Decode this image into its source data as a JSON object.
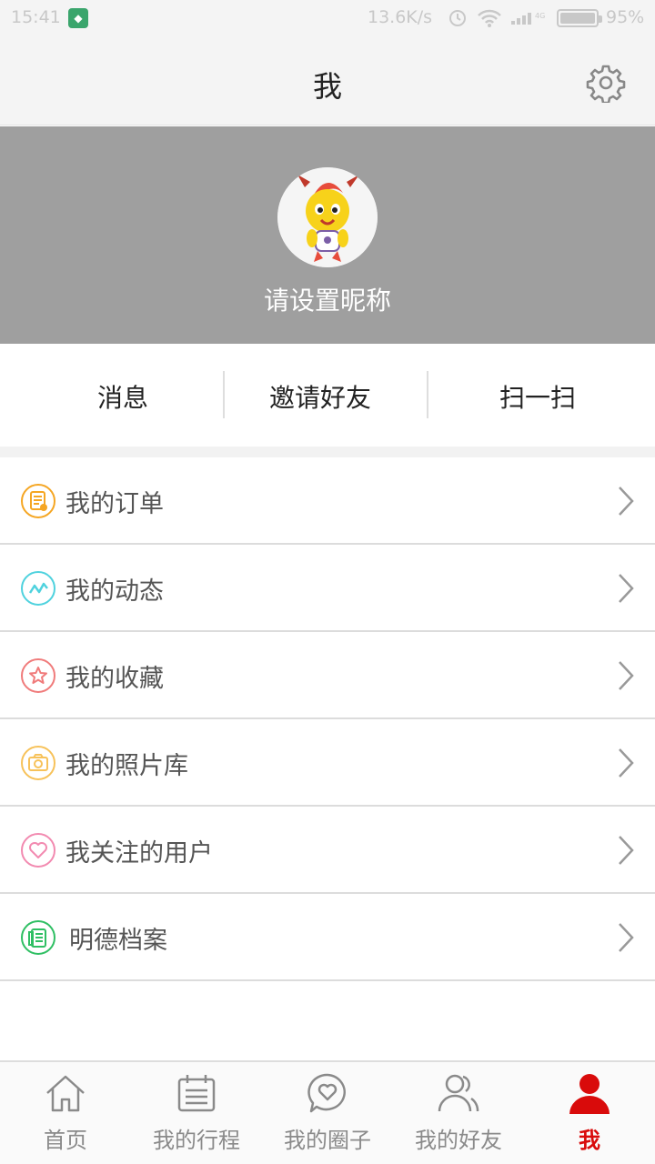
{
  "status_bar": {
    "time": "15:41",
    "net_speed": "13.6K/s",
    "battery": "95%"
  },
  "header": {
    "title": "我"
  },
  "profile": {
    "nickname": "请设置昵称"
  },
  "quick_actions": [
    {
      "label": "消息"
    },
    {
      "label": "邀请好友"
    },
    {
      "label": "扫一扫"
    }
  ],
  "menu": [
    {
      "label": "我的订单",
      "icon": "order-icon",
      "color": "#f5a623"
    },
    {
      "label": "我的动态",
      "icon": "activity-icon",
      "color": "#4fd2de"
    },
    {
      "label": "我的收藏",
      "icon": "star-icon",
      "color": "#f07b7b"
    },
    {
      "label": "我的照片库",
      "icon": "camera-icon",
      "color": "#f7c25a"
    },
    {
      "label": "我关注的用户",
      "icon": "heart-icon",
      "color": "#f28ab0"
    },
    {
      "label": "明德档案",
      "icon": "archive-icon",
      "color": "#2fbf63"
    }
  ],
  "tabs": [
    {
      "label": "首页",
      "icon": "home-icon"
    },
    {
      "label": "我的行程",
      "icon": "calendar-icon"
    },
    {
      "label": "我的圈子",
      "icon": "chat-heart-icon"
    },
    {
      "label": "我的好友",
      "icon": "friends-icon"
    },
    {
      "label": "我",
      "icon": "person-icon",
      "active": true
    }
  ],
  "colors": {
    "active_tab": "#d90b0b",
    "profile_bg": "#9f9f9f",
    "bar_bg": "#f4f4f4"
  }
}
